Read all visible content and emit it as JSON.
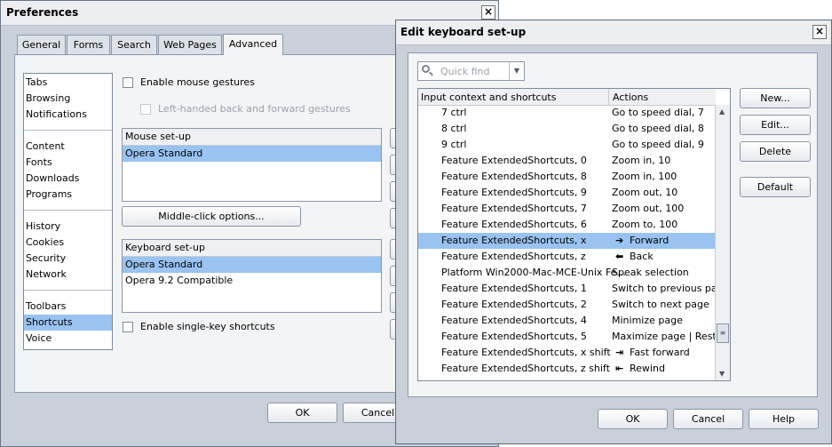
{
  "preferences": {
    "title": "Preferences",
    "close_label": "×",
    "tabs": [
      "General",
      "Forms",
      "Search",
      "Web Pages",
      "Advanced"
    ],
    "sidebar": {
      "group1": [
        "Tabs",
        "Browsing",
        "Notifications"
      ],
      "group2": [
        "Content",
        "Fonts",
        "Downloads",
        "Programs"
      ],
      "group3": [
        "History",
        "Cookies",
        "Security",
        "Network"
      ],
      "group4": [
        "Toolbars",
        "Shortcuts",
        "Voice"
      ],
      "selected": "Shortcuts"
    },
    "enable_mouse_gestures": "Enable mouse gestures",
    "left_handed": "Left-handed back and forward gestures",
    "mouse_setup": {
      "header": "Mouse set-up",
      "items": [
        "Opera Standard"
      ]
    },
    "middle_click": "Middle-click options...",
    "keyboard_setup": {
      "header": "Keyboard set-up",
      "items": [
        "Opera Standard",
        "Opera 9.2 Compatible"
      ]
    },
    "enable_single_key": "Enable single-key shortcuts",
    "ok": "OK",
    "cancel": "Cancel"
  },
  "keyboard_dialog": {
    "title": "Edit keyboard set-up",
    "close_label": "×",
    "quick_find_placeholder": "Quick find",
    "col_input": "Input context and shortcuts",
    "col_actions": "Actions",
    "rows": [
      {
        "key": "7 ctrl",
        "action": "Go to speed dial, 7",
        "icon": ""
      },
      {
        "key": "8 ctrl",
        "action": "Go to speed dial, 8",
        "icon": ""
      },
      {
        "key": "9 ctrl",
        "action": "Go to speed dial, 9",
        "icon": ""
      },
      {
        "key": "Feature ExtendedShortcuts, 0",
        "action": "Zoom in, 10",
        "icon": ""
      },
      {
        "key": "Feature ExtendedShortcuts, 8",
        "action": "Zoom in, 100",
        "icon": ""
      },
      {
        "key": "Feature ExtendedShortcuts, 9",
        "action": "Zoom out, 10",
        "icon": ""
      },
      {
        "key": "Feature ExtendedShortcuts, 7",
        "action": "Zoom out, 100",
        "icon": ""
      },
      {
        "key": "Feature ExtendedShortcuts, 6",
        "action": "Zoom to, 100",
        "icon": ""
      },
      {
        "key": "Feature ExtendedShortcuts, x",
        "action": "Forward",
        "icon": "➔"
      },
      {
        "key": "Feature ExtendedShortcuts, z",
        "action": "Back",
        "icon": "⬅"
      },
      {
        "key": "Platform Win2000-Mac-MCE-Unix Fe...",
        "action": "Speak selection",
        "icon": ""
      },
      {
        "key": "Feature ExtendedShortcuts, 1",
        "action": "Switch to previous page",
        "icon": ""
      },
      {
        "key": "Feature ExtendedShortcuts, 2",
        "action": "Switch to next page",
        "icon": ""
      },
      {
        "key": "Feature ExtendedShortcuts, 4",
        "action": "Minimize page",
        "icon": ""
      },
      {
        "key": "Feature ExtendedShortcuts, 5",
        "action": "Maximize page | Rest...",
        "icon": ""
      },
      {
        "key": "Feature ExtendedShortcuts, x shift",
        "action": "Fast forward",
        "icon": "⇥"
      },
      {
        "key": "Feature ExtendedShortcuts, z shift",
        "action": "Rewind",
        "icon": "⇤"
      }
    ],
    "selected_index": 8,
    "side_buttons": [
      "New...",
      "Edit...",
      "Delete",
      "Default"
    ],
    "ok": "OK",
    "cancel": "Cancel",
    "help": "Help"
  }
}
